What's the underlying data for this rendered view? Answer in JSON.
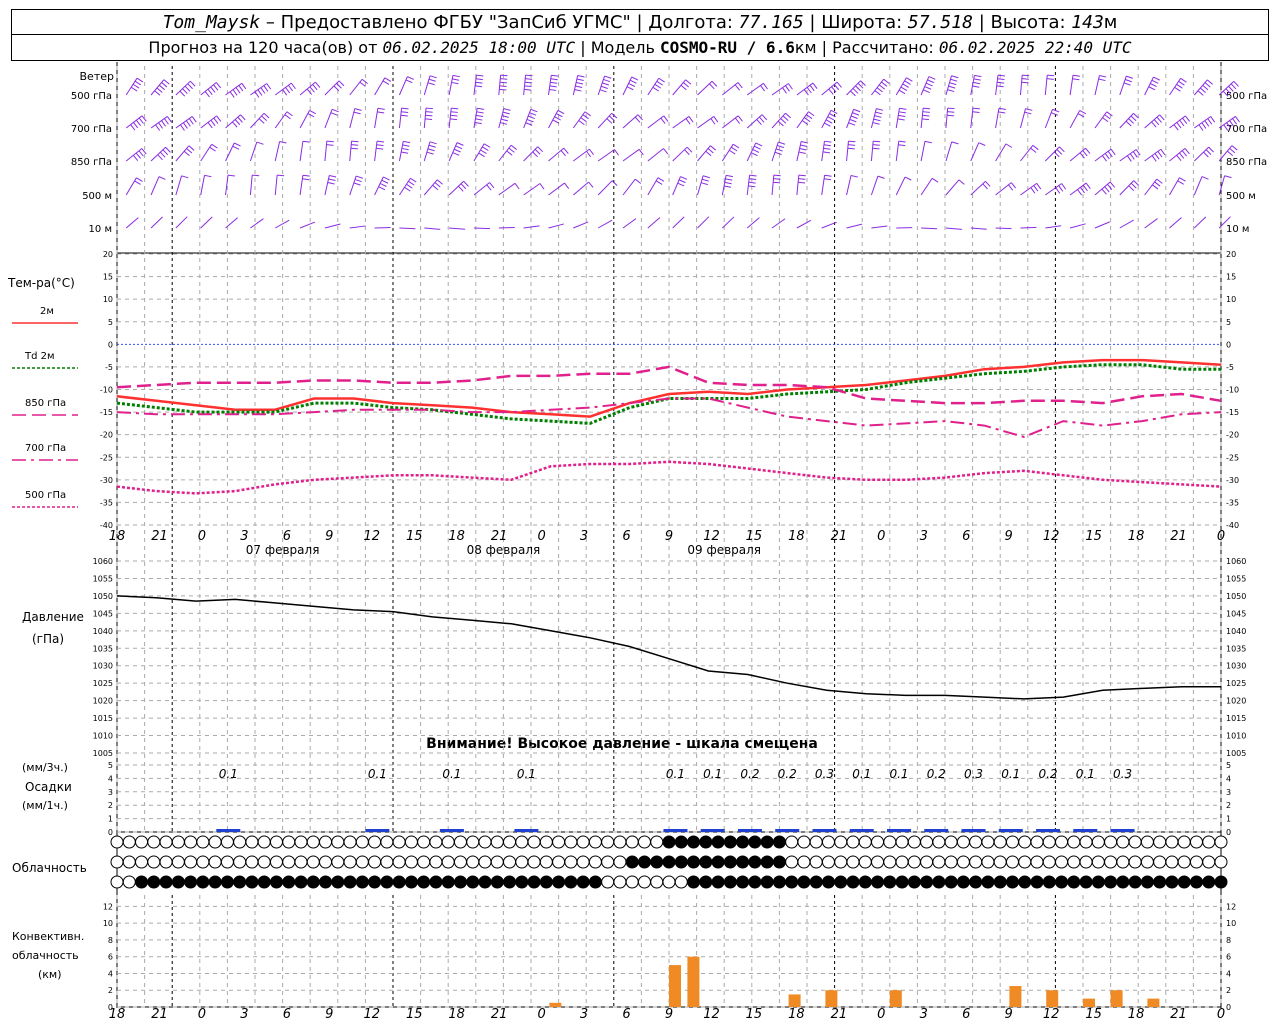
{
  "header": {
    "station": "Tom_Maysk",
    "provider": "Предоставлено ФГБУ \"ЗапСиб УГМС\"",
    "longitude_label": "Долгота:",
    "longitude": "77.165",
    "latitude_label": "Широта:",
    "latitude": "57.518",
    "altitude_label": "Высота:",
    "altitude": "143",
    "altitude_unit": "м",
    "forecast_prefix": "Прогноз на 120 часа(ов) от",
    "forecast_time": "06.02.2025 18:00 UTC",
    "model_label": "Модель",
    "model": "COSMO-RU / 6.6",
    "model_unit": "км",
    "calc_label": "Рассчитано:",
    "calc_time": "06.02.2025 22:40 UTC"
  },
  "wind_panel": {
    "title": "Ветер",
    "levels": [
      "500 гПа",
      "700 гПа",
      "850 гПа",
      "500 м",
      "10  м"
    ],
    "barb_color": "#8a2be2"
  },
  "temp_panel": {
    "title": "Тем-ра(°C)",
    "ylim": [
      -40,
      20
    ],
    "ticks": [
      "20",
      "15",
      "10",
      "5",
      "0",
      "-5",
      "-10",
      "-15",
      "-20",
      "-25",
      "-30",
      "-35",
      "-40"
    ]
  },
  "time_axis": {
    "hour_ticks": [
      "18",
      "21",
      "0",
      "3",
      "6",
      "9",
      "12",
      "15",
      "18",
      "21",
      "0",
      "3",
      "6",
      "9",
      "12",
      "15",
      "18",
      "21",
      "0",
      "3",
      "6",
      "9",
      "12",
      "15",
      "18",
      "21",
      "0"
    ],
    "dates": [
      "07 февраля",
      "08 февраля",
      "09 февраля"
    ]
  },
  "pressure_panel": {
    "title_line1": "Давление",
    "title_line2": "(гПа)",
    "ticks": [
      "1060",
      "1055",
      "1050",
      "1045",
      "1040",
      "1035",
      "1030",
      "1025",
      "1020",
      "1015",
      "1010",
      "1005"
    ],
    "warning": "Внимание! Высокое давление - шкала смещена"
  },
  "precip_panel": {
    "label_3h": "(мм/3ч.)",
    "title": "Осадки",
    "label_1h": "(мм/1ч.)",
    "ticks": [
      "5",
      "4",
      "3",
      "2",
      "1",
      "0"
    ],
    "amounts": [
      {
        "hour": 6,
        "text": "0.1"
      },
      {
        "hour": 18,
        "text": "0.1"
      },
      {
        "hour": 24,
        "text": "0.1"
      },
      {
        "hour": 30,
        "text": "0.1"
      },
      {
        "hour": 42,
        "text": "0.1"
      },
      {
        "hour": 45,
        "text": "0.1"
      },
      {
        "hour": 48,
        "text": "0.2"
      },
      {
        "hour": 51,
        "text": "0.2"
      },
      {
        "hour": 54,
        "text": "0.3"
      },
      {
        "hour": 57,
        "text": "0.1"
      },
      {
        "hour": 60,
        "text": "0.1"
      },
      {
        "hour": 63,
        "text": "0.2"
      },
      {
        "hour": 66,
        "text": "0.3"
      },
      {
        "hour": 69,
        "text": "0.1"
      },
      {
        "hour": 72,
        "text": "0.2"
      },
      {
        "hour": 75,
        "text": "0.1"
      },
      {
        "hour": 78,
        "text": "0.3"
      }
    ]
  },
  "cloud_panel": {
    "title": "Облачность"
  },
  "conv_panel": {
    "title_line1": "Конвективн.",
    "title_line2": "облачность",
    "title_line3": "(км)",
    "ticks": [
      "12",
      "10",
      "8",
      "6",
      "4",
      "2",
      "0"
    ]
  },
  "chart_data": [
    {
      "type": "line",
      "title": "Тем-ра(°C)",
      "x_hours_from_start": [
        0,
        3,
        6,
        9,
        12,
        15,
        18,
        21,
        24,
        27,
        30,
        33,
        36,
        39,
        42,
        45,
        48,
        51,
        54,
        57,
        60,
        63,
        66,
        69,
        72,
        75,
        78
      ],
      "ylim": [
        -40,
        20
      ],
      "series": [
        {
          "name": "2м",
          "color": "#ff3030",
          "values": [
            -11.5,
            -12.5,
            -13.5,
            -14.5,
            -14.5,
            -12,
            -12,
            -13,
            -13.5,
            -14,
            -15,
            -15.5,
            -16,
            -13,
            -11,
            -10.5,
            -11,
            -10,
            -9.5,
            -9,
            -8,
            -7,
            -5.5,
            -5,
            -4,
            -3.5,
            -3.5,
            -4,
            -4.5
          ]
        },
        {
          "name": "Td 2м",
          "color": "#008000",
          "values": [
            -13,
            -14,
            -15,
            -15,
            -15,
            -13,
            -13,
            -14,
            -14.5,
            -15.5,
            -16.5,
            -17,
            -17.5,
            -14,
            -12,
            -12,
            -12,
            -11,
            -10.5,
            -10,
            -8.5,
            -7.5,
            -6.5,
            -6,
            -5,
            -4.5,
            -4.5,
            -5.5,
            -5.5
          ]
        },
        {
          "name": "850 гПа",
          "color": "#e0208c",
          "values": [
            -9.5,
            -9,
            -8.5,
            -8.5,
            -8.5,
            -8,
            -8,
            -8.5,
            -8.5,
            -8,
            -7,
            -7,
            -6.5,
            -6.5,
            -5,
            -8.5,
            -9,
            -9,
            -9.5,
            -12,
            -12.5,
            -13,
            -13,
            -12.5,
            -12.5,
            -13,
            -11.5,
            -11,
            -12.5
          ]
        },
        {
          "name": "700 гПа",
          "color": "#e0208c",
          "values": [
            -15,
            -15.5,
            -15.5,
            -15.5,
            -15.5,
            -15,
            -14.5,
            -14.5,
            -14.5,
            -15,
            -15,
            -14.5,
            -14,
            -13,
            -12,
            -12,
            -14,
            -16,
            -17,
            -18,
            -17.5,
            -17,
            -18,
            -20.5,
            -17,
            -18,
            -17,
            -15.5,
            -15
          ]
        },
        {
          "name": "500 гПа",
          "color": "#e0208c",
          "values": [
            -31.5,
            -32.5,
            -33,
            -32.5,
            -31,
            -30,
            -29.5,
            -29,
            -29,
            -29.5,
            -30,
            -27,
            -26.5,
            -26.5,
            -26,
            -26.5,
            -27.5,
            -28.5,
            -29.5,
            -30,
            -30,
            -29.5,
            -28.5,
            -28,
            -29,
            -30,
            -30.5,
            -31,
            -31.5
          ]
        }
      ]
    },
    {
      "type": "line",
      "title": "Давление (гПа)",
      "ylim": [
        1005,
        1060
      ],
      "series": [
        {
          "name": "pressure",
          "color": "#000000",
          "values": [
            1050,
            1049.5,
            1048.5,
            1049,
            1048,
            1047,
            1046,
            1045.5,
            1044,
            1043,
            1042,
            1040,
            1038,
            1035.5,
            1032,
            1028.5,
            1027.5,
            1025,
            1023,
            1022,
            1021.5,
            1021.5,
            1021,
            1020.5,
            1021,
            1023,
            1023.5,
            1024,
            1024
          ]
        }
      ]
    }
  ]
}
